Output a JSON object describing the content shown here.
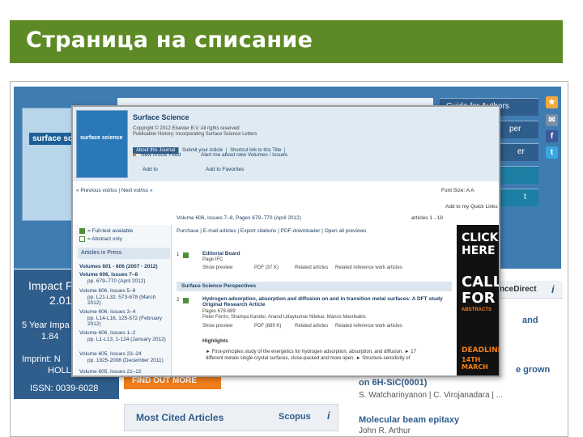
{
  "slide": {
    "title": "Страница на списание",
    "accent_color": "#5e8a25"
  },
  "background_page": {
    "cover_title": "surface science",
    "sidebar_buttons": [
      "Guide for Authors",
      "per",
      "er",
      "",
      "t"
    ],
    "impact_value_label": "Impact F",
    "impact_year": "2.01",
    "impact_lines": [
      "5 Year Impa",
      "1.84",
      "Imprint: N",
      "HOLLA"
    ],
    "issn": "ISSN: 0039-6028",
    "find_more": "FIND OUT MORE",
    "most_cited": {
      "title": "Most Cited Articles",
      "source": "Scopus",
      "info": "i"
    },
    "sciencedirect": {
      "label": "nceDirect",
      "info": "i"
    },
    "right_items": [
      {
        "text": "and",
        "author": ""
      },
      {
        "text": "e grown",
        "author": ""
      },
      {
        "text": "on 6H-SiC(0001)",
        "author": "S. Watcharinyanon | C. Virojanadara | ..."
      },
      {
        "text": "Molecular beam epitaxy",
        "author": "John R. Arthur"
      }
    ]
  },
  "overlay": {
    "journal_title": "Surface Science",
    "copyright": "Copyright © 2012 Elsevier B.V. All rights reserved",
    "history": "Publication History: Incorporating Surface Science Letters",
    "tabs": [
      "About this Journal",
      "Submit your Article",
      "Shortcut link to this Title"
    ],
    "links": {
      "feed": "New Article Feed",
      "alert": "Alert me about new Volumes / Issues",
      "collab": "Add to",
      "favorites": "Add to Favorites"
    },
    "prev_next": "« Previous vol/iss  |  Next vol/iss »",
    "font_size": "Font Size: A A",
    "add_query": "Add to my Quick Links",
    "volume_line": "Volume 606, Issues 7–8, Pages 679–770 (April 2012)",
    "articles_count": "articles 1 - 18",
    "left_panel": {
      "fulltext": "= Full-text available",
      "abstract": "= Abstract only",
      "in_press": "Articles in Press",
      "volumes": [
        "Volumes 601 - 606 (2007 - 2012)",
        "Volume 606, Issues 7–8",
        "pp. 679–770 (April 2012)",
        "Volume 606, Issues 5–6",
        "pp. L21-L32, 573-678 (March 2012)",
        "Volume 606, Issues 3–4",
        "pp. L14-L16, 125-572 (February 2012)",
        "Volume 606, Issues 1–2",
        "pp. L1-L13, 1-124 (January 2012)",
        "Volume 605, Issues 23–24",
        "pp. 1925-2008 (December 2011)",
        "Volume 605, Issues 21–22"
      ]
    },
    "toolbar": [
      "Purchase",
      "E-mail articles",
      "Export citations",
      "PDF-downloader",
      "Open all previews"
    ],
    "articles": [
      {
        "num": "1",
        "title": "Editorial Board",
        "pages": "Page IFC",
        "actions": [
          "Show preview",
          "PDF (37 K)",
          "Related articles",
          "Related reference work articles"
        ]
      }
    ],
    "section": "Surface Science Perspectives",
    "article2": {
      "num": "2",
      "title": "Hydrogen adsorption, absorption and diffusion on and in transition metal surfaces: A DFT study Original Research Article",
      "pages": "Pages 679-689",
      "authors": "Peter Ferrin, Shampa Kandoi, Anand Udaykumar Nilekar, Manos Mavrikakis",
      "actions": [
        "Show preview",
        "PDF (889 K)",
        "Related articles",
        "Related reference work articles"
      ]
    },
    "highlights_label": "Highlights",
    "bullets": [
      "► First-principles study of the energetics for hydrogen adsorption, absorption, and diffusion. ► 17",
      "different metals single crystal surfaces, close-packed and more open. ► Structure-sensitivity of"
    ],
    "ad": {
      "line1": "CLICK",
      "line2": "HERE",
      "line3": "CALL",
      "line4": "FOR",
      "line5": "ABSTRACTS",
      "line6": "DEADLINE",
      "line7": "14TH MARCH"
    }
  }
}
